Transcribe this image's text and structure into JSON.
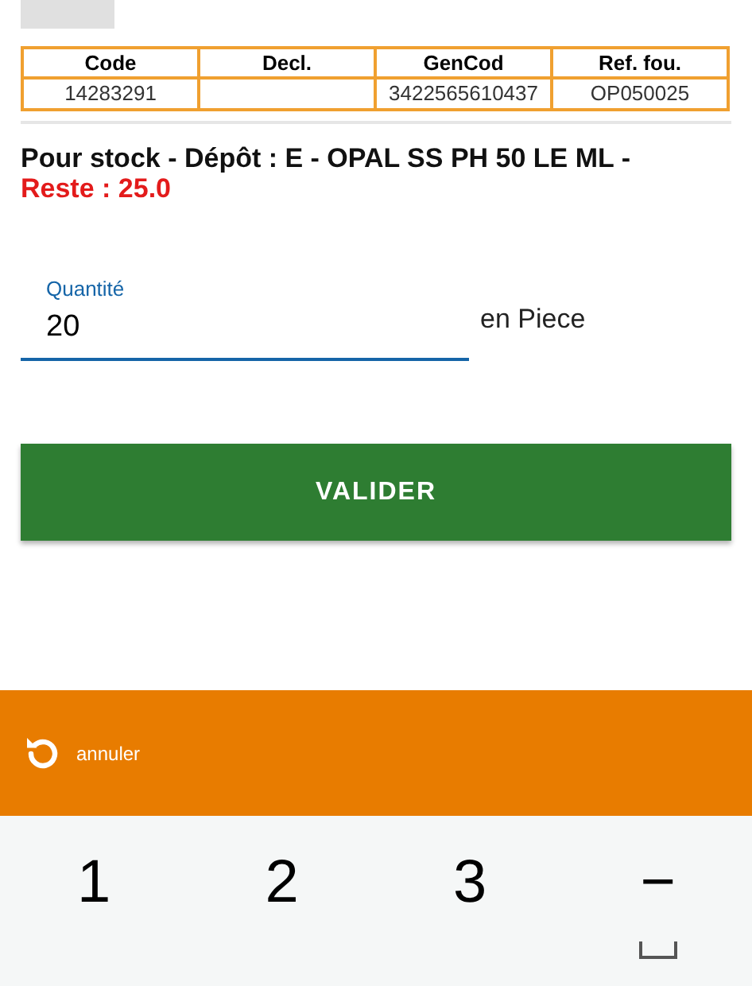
{
  "table": {
    "columns": [
      "Code",
      "Decl.",
      "GenCod",
      "Ref. fou."
    ],
    "rows": [
      [
        "14283291",
        "",
        "3422565610437",
        "OP050025"
      ]
    ]
  },
  "info": {
    "description": "Pour stock - Dépôt : E - OPAL SS PH 50 LE ML -",
    "remaining": "Reste : 25.0"
  },
  "quantity": {
    "label": "Quantité",
    "value": "20",
    "unit": "en Piece"
  },
  "validate_button": "VALIDER",
  "cancel_bar": {
    "label": "annuler"
  },
  "keypad": [
    {
      "kind": "digit",
      "label": "1"
    },
    {
      "kind": "digit",
      "label": "2"
    },
    {
      "kind": "digit",
      "label": "3"
    },
    {
      "kind": "digit",
      "label": "−"
    },
    {
      "kind": "space"
    }
  ]
}
